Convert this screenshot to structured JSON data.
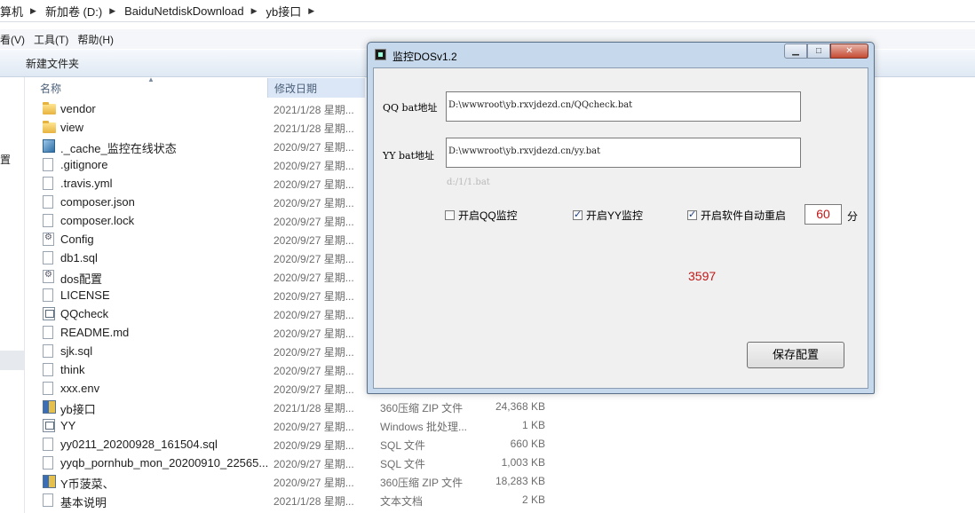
{
  "address": {
    "crumbs": [
      "算机",
      "新加卷 (D:)",
      "BaiduNetdiskDownload",
      "yb接口"
    ]
  },
  "menu": {
    "items": [
      "看(V)",
      "工具(T)",
      "帮助(H)"
    ]
  },
  "toolbar": {
    "new_folder": "新建文件夹"
  },
  "nav": {
    "partial_label": "置"
  },
  "columns": {
    "name": "名称",
    "date": "修改日期"
  },
  "files": [
    {
      "name": "vendor",
      "date": "2021/1/28 星期...",
      "type": "",
      "size": "",
      "icon": "folder-icon"
    },
    {
      "name": "view",
      "date": "2021/1/28 星期...",
      "type": "",
      "size": "",
      "icon": "folder-icon"
    },
    {
      "name": "._cache_监控在线状态",
      "date": "2020/9/27 星期...",
      "type": "",
      "size": "",
      "icon": "url-icon"
    },
    {
      "name": ".gitignore",
      "date": "2020/9/27 星期...",
      "type": "",
      "size": "",
      "icon": "document-icon"
    },
    {
      "name": ".travis.yml",
      "date": "2020/9/27 星期...",
      "type": "",
      "size": "",
      "icon": "document-icon"
    },
    {
      "name": "composer.json",
      "date": "2020/9/27 星期...",
      "type": "",
      "size": "",
      "icon": "document-icon"
    },
    {
      "name": "composer.lock",
      "date": "2020/9/27 星期...",
      "type": "",
      "size": "",
      "icon": "document-icon"
    },
    {
      "name": "Config",
      "date": "2020/9/27 星期...",
      "type": "",
      "size": "",
      "icon": "config-icon"
    },
    {
      "name": "db1.sql",
      "date": "2020/9/27 星期...",
      "type": "",
      "size": "",
      "icon": "document-icon"
    },
    {
      "name": "dos配置",
      "date": "2020/9/27 星期...",
      "type": "",
      "size": "",
      "icon": "config-icon"
    },
    {
      "name": "LICENSE",
      "date": "2020/9/27 星期...",
      "type": "",
      "size": "",
      "icon": "document-icon"
    },
    {
      "name": "QQcheck",
      "date": "2020/9/27 星期...",
      "type": "",
      "size": "",
      "icon": "batch-icon"
    },
    {
      "name": "README.md",
      "date": "2020/9/27 星期...",
      "type": "",
      "size": "",
      "icon": "document-icon"
    },
    {
      "name": "sjk.sql",
      "date": "2020/9/27 星期...",
      "type": "",
      "size": "",
      "icon": "document-icon"
    },
    {
      "name": "think",
      "date": "2020/9/27 星期...",
      "type": "",
      "size": "",
      "icon": "document-icon"
    },
    {
      "name": "xxx.env",
      "date": "2020/9/27 星期...",
      "type": "",
      "size": "",
      "icon": "document-icon"
    },
    {
      "name": "yb接口",
      "date": "2021/1/28 星期...",
      "type": "360压缩 ZIP 文件",
      "size": "24,368 KB",
      "icon": "archive-icon"
    },
    {
      "name": "YY",
      "date": "2020/9/27 星期...",
      "type": "Windows 批处理...",
      "size": "1 KB",
      "icon": "batch-icon"
    },
    {
      "name": "yy0211_20200928_161504.sql",
      "date": "2020/9/29 星期...",
      "type": "SQL 文件",
      "size": "660 KB",
      "icon": "document-icon"
    },
    {
      "name": "yyqb_pornhub_mon_20200910_22565...",
      "date": "2020/9/27 星期...",
      "type": "SQL 文件",
      "size": "1,003 KB",
      "icon": "document-icon"
    },
    {
      "name": "Y币菠菜、",
      "date": "2020/9/27 星期...",
      "type": "360压缩 ZIP 文件",
      "size": "18,283 KB",
      "icon": "archive-icon"
    },
    {
      "name": "基本说明",
      "date": "2021/1/28 星期...",
      "type": "文本文档",
      "size": "2 KB",
      "icon": "document-icon"
    }
  ],
  "dialog": {
    "title": "监控DOSv1.2",
    "window_buttons": {
      "minimize": "▁",
      "maximize": "□",
      "close": "✕"
    },
    "qq_label": "QQ bat地址",
    "qq_value": "D:\\wwwroot\\yb.rxvjdezd.cn/QQcheck.bat",
    "yy_label": "YY bat地址",
    "yy_value": "D:\\wwwroot\\yb.rxvjdezd.cn/yy.bat",
    "path_hint": "d:/1/1.bat",
    "qq_monitor": {
      "label": "开启QQ监控",
      "checked": false
    },
    "yy_monitor": {
      "label": "开启YY监控",
      "checked": true
    },
    "auto_restart": {
      "label": "开启软件自动重启",
      "checked": true
    },
    "restart_minutes": "60",
    "minutes_unit": "分",
    "counter": "3597",
    "save_button": "保存配置"
  }
}
